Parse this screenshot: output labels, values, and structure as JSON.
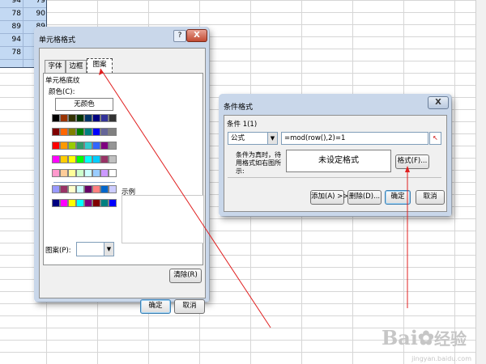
{
  "sheet": {
    "rows": [
      [
        "94",
        "79"
      ],
      [
        "78",
        "90"
      ],
      [
        "89",
        "89"
      ],
      [
        "94",
        "92"
      ],
      [
        "78",
        ""
      ]
    ]
  },
  "cell_format_dialog": {
    "title": "单元格格式",
    "help": "?",
    "close": "X",
    "tabs": [
      "字体",
      "边框",
      "图案"
    ],
    "active_tab": "图案",
    "section_label": "单元格底纹",
    "color_label": "颜色(C):",
    "no_color": "无颜色",
    "sample_label": "示例",
    "pattern_label": "图案(P):",
    "clear_button": "清除(R)",
    "ok_button": "确定",
    "cancel_button": "取消",
    "palette": [
      [
        "#000000",
        "#993300",
        "#333300",
        "#003300",
        "#003366",
        "#000080",
        "#333399",
        "#333333"
      ],
      [
        "#800000",
        "#ff6600",
        "#808000",
        "#008000",
        "#008080",
        "#0000ff",
        "#666699",
        "#808080"
      ],
      [
        "#ff0000",
        "#ff9900",
        "#99cc00",
        "#339966",
        "#33cccc",
        "#3366ff",
        "#800080",
        "#969696"
      ],
      [
        "#ff00ff",
        "#ffcc00",
        "#ffff00",
        "#00ff00",
        "#00ffff",
        "#00ccff",
        "#993366",
        "#c0c0c0"
      ],
      [
        "#ff99cc",
        "#ffcc99",
        "#ffff99",
        "#ccffcc",
        "#ccffff",
        "#99ccff",
        "#cc99ff",
        "#ffffff"
      ],
      [
        "#9999ff",
        "#993366",
        "#ffffcc",
        "#ccffff",
        "#660066",
        "#ff8080",
        "#0066cc",
        "#ccccff"
      ],
      [
        "#000080",
        "#ff00ff",
        "#ffff00",
        "#00ffff",
        "#800080",
        "#800000",
        "#008080",
        "#0000ff"
      ]
    ]
  },
  "conditional_dialog": {
    "title": "条件格式",
    "close": "X",
    "condition_label": "条件 1(1)",
    "type_value": "公式",
    "formula_value": "=mod(row(),2)=1",
    "preview_caption": "条件为真时，待用格式如右图所示:",
    "preview_text": "未设定格式",
    "format_button": "格式(F)...",
    "add_button": "添加(A) >>",
    "delete_button": "删除(D)...",
    "ok_button": "确定",
    "cancel_button": "取消"
  },
  "watermark": {
    "logo": "Bai",
    "logo2": "经验",
    "url": "jingyan.baidu.com"
  },
  "colors": {
    "annotation_red": "#e02020",
    "selection_blue": "#c3d9f3",
    "dialog_bg": "#f0f0f0"
  }
}
